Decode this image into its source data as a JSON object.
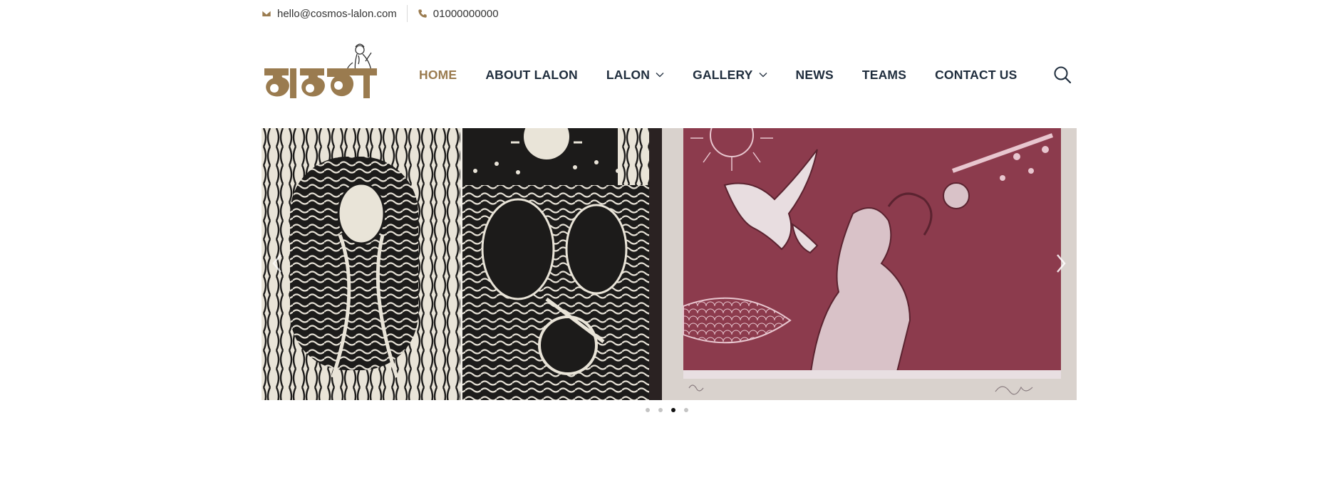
{
  "contact": {
    "email": "hello@cosmos-lalon.com",
    "phone": "01000000000",
    "email_icon": "envelope-icon",
    "phone_icon": "phone-icon"
  },
  "logo": {
    "text": "লালন",
    "alt": "Lalon logo"
  },
  "nav": {
    "items": [
      {
        "label": "HOME",
        "active": true,
        "dropdown": false
      },
      {
        "label": "ABOUT LALON",
        "active": false,
        "dropdown": false
      },
      {
        "label": "LALON",
        "active": false,
        "dropdown": true
      },
      {
        "label": "GALLERY",
        "active": false,
        "dropdown": true
      },
      {
        "label": "NEWS",
        "active": false,
        "dropdown": false
      },
      {
        "label": "TEAMS",
        "active": false,
        "dropdown": false
      },
      {
        "label": "CONTACT US",
        "active": false,
        "dropdown": false
      }
    ],
    "search_icon": "search-icon"
  },
  "slider": {
    "slide_count": 4,
    "active_index": 2,
    "prev_icon": "chevron-left-icon",
    "next_icon": "chevron-right-icon"
  },
  "colors": {
    "accent": "#9a7b4f",
    "nav_text": "#1f2d3d",
    "dot_inactive": "#c4c4c4",
    "dot_active": "#111111"
  }
}
